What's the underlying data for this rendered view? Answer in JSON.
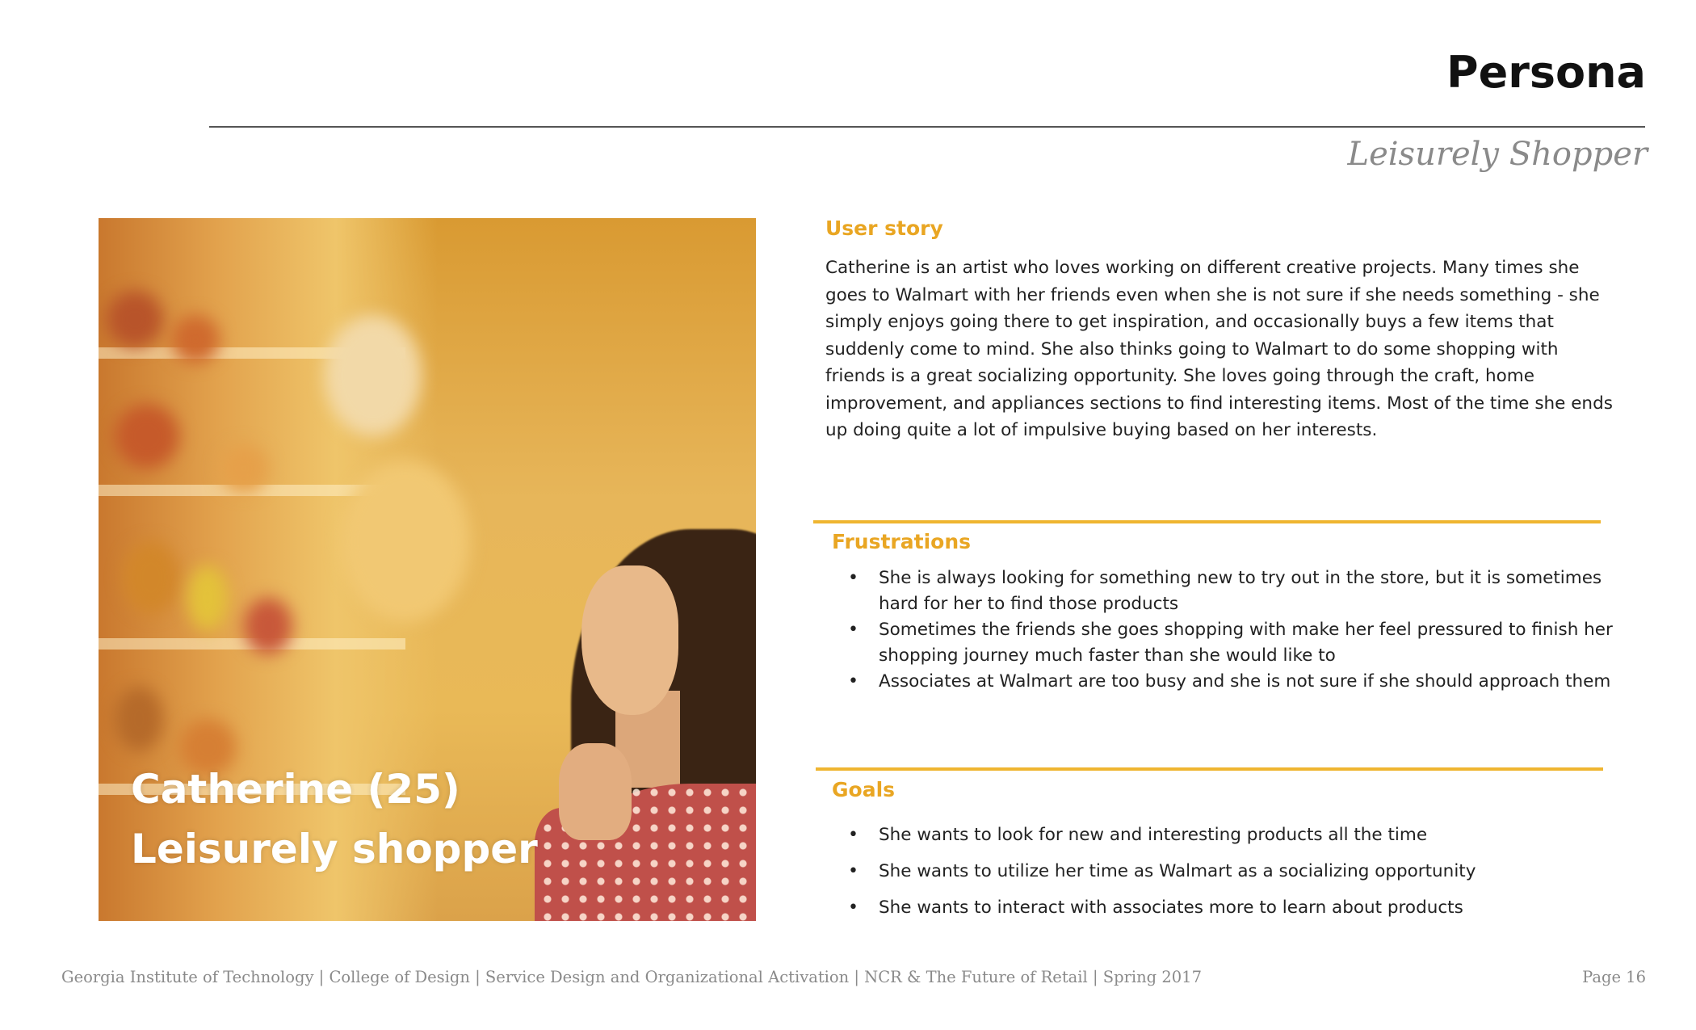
{
  "header": {
    "title": "Persona",
    "subtitle": "Leisurely Shopper"
  },
  "photo": {
    "caption_line1": "Catherine (25)",
    "caption_line2": "Leisurely shopper"
  },
  "user_story": {
    "heading": "User story",
    "text": "Catherine is an artist who loves working on different creative projects. Many times she goes to Walmart with her friends even when she is not sure if she needs something - she simply enjoys going there to get inspiration, and occasionally buys a few items that suddenly come to mind. She also thinks going to Walmart to do some shopping with friends is a great socializing opportunity. She loves going through the craft, home improvement, and appliances sections to find interesting items. Most of the time she ends up doing quite a lot of impulsive buying based on her interests."
  },
  "frustrations": {
    "heading": "Frustrations",
    "items": [
      "She is always looking for something new to try out in the store, but it is sometimes hard for her to find those products",
      "Sometimes the friends she goes shopping with make her feel pressured to finish her shopping journey much faster than she would like to",
      "Associates at Walmart are too busy and she is not sure if she should approach them"
    ]
  },
  "goals": {
    "heading": "Goals",
    "items": [
      "She wants to look for new and interesting products all the time",
      "She wants to utilize her time as Walmart as a socializing opportunity",
      "She wants to interact with associates more to learn about products"
    ]
  },
  "footer": {
    "left": "Georgia Institute of Technology | College of Design | Service Design and Organizational Activation | NCR & The Future of Retail | Spring 2017",
    "right": "Page 16"
  },
  "colors": {
    "accent": "#e9a623",
    "rule": "#efb530",
    "muted_text": "#8a8a8a"
  }
}
